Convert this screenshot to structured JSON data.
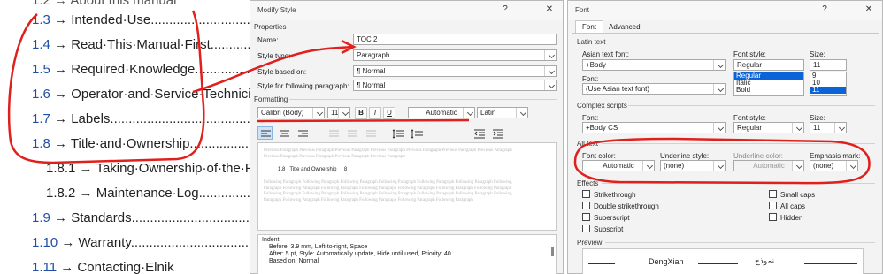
{
  "document": {
    "top_partial": "1.2 → About this manual",
    "toc": [
      {
        "num": "1.3",
        "text": "→ Intended·Use..........................................."
      },
      {
        "num": "1.4",
        "text": "→ Read·This·Manual·First..............................."
      },
      {
        "num": "1.5",
        "text": "→ Required·Knowledge.................................."
      },
      {
        "num": "1.6",
        "text": "→ Operator·and·Service·Technician"
      },
      {
        "num": "1.7",
        "text": "→ Labels..............................................."
      },
      {
        "num": "1.8",
        "text": "→ Title·and·Ownership........................"
      },
      {
        "num": "1.8.1",
        "text": "→ Taking·Ownership·of·the·F"
      },
      {
        "num": "1.8.2",
        "text": "→ Maintenance·Log.........................."
      },
      {
        "num": "1.9",
        "text": "→ Standards............................................"
      },
      {
        "num": "1.10",
        "text": "→ Warranty............................................"
      },
      {
        "num": "1.11",
        "text": "→ Contacting·Elnik"
      }
    ]
  },
  "modify_style": {
    "title": "Modify Style",
    "help": "?",
    "close": "✕",
    "properties_label": "Properties",
    "name_label": "Name:",
    "name_value": "TOC 2",
    "style_type_label": "Style type:",
    "style_type_value": "Paragraph",
    "style_based_label": "Style based on:",
    "style_based_value": "¶  Normal",
    "style_following_label": "Style for following paragraph:",
    "style_following_value": "¶  Normal",
    "formatting_label": "Formatting",
    "font_value": "Calibri (Body)",
    "size_value": "11",
    "bold": "B",
    "italic": "I",
    "underline": "U",
    "color_value": "Automatic",
    "script_value": "Latin",
    "preview_previous": "Previous Paragraph Previous Paragraph Previous Paragraph Previous Paragraph Previous Paragraph Previous Paragraph Previous Paragraph Previous Paragraph Previous Paragraph Previous Paragraph Previous Paragraph",
    "preview_sample_num": "1.8",
    "preview_sample_text": "Title and Ownership",
    "preview_sample_page": "8",
    "preview_following": "Following Paragraph Following Paragraph Following Paragraph Following Paragraph Following Paragraph Following Paragraph Following Paragraph Following Paragraph Following Paragraph Following Paragraph Following Paragraph Following Paragraph Following Paragraph Following Paragraph Following Paragraph Following Paragraph Following Paragraph Following Paragraph Following Paragraph Following Paragraph Following Paragraph Following Paragraph Following Paragraph Following Paragraph Following Paragraph",
    "desc_line1": "Indent:",
    "desc_line2": "Before:  3.9 mm, Left-to-right, Space",
    "desc_line3": "After:  5 pt, Style: Automatically update, Hide until used, Priority: 40",
    "desc_line4": "Based on: Normal"
  },
  "font_dialog": {
    "title": "Font",
    "help": "?",
    "close": "✕",
    "tab_font": "Font",
    "tab_advanced": "Advanced",
    "latin_text_label": "Latin text",
    "asian_font_label": "Asian text font:",
    "asian_font_value": "+Body",
    "font_label": "Font:",
    "font_value": "(Use Asian text font)",
    "font_style_label": "Font style:",
    "font_style_value": "Regular",
    "font_style_options": [
      "Regular",
      "Italic",
      "Bold"
    ],
    "size_label": "Size:",
    "size_value": "11",
    "size_options": [
      "9",
      "10",
      "11"
    ],
    "complex_scripts_label": "Complex scripts",
    "complex_font_label": "Font:",
    "complex_font_value": "+Body CS",
    "complex_style_label": "Font style:",
    "complex_style_value": "Regular",
    "complex_size_label": "Size:",
    "complex_size_value": "11",
    "all_text_label": "All text",
    "font_color_label": "Font color:",
    "font_color_value": "Automatic",
    "underline_style_label": "Underline style:",
    "underline_style_value": "(none)",
    "underline_color_label": "Underline color:",
    "underline_color_value": "Automatic",
    "emphasis_label": "Emphasis mark:",
    "emphasis_value": "(none)",
    "effects_label": "Effects",
    "strikethrough": "Strikethrough",
    "double_strikethrough": "Double strikethrough",
    "superscript": "Superscript",
    "subscript": "Subscript",
    "small_caps": "Small caps",
    "all_caps": "All caps",
    "hidden": "Hidden",
    "preview_label": "Preview",
    "preview_latin": "DengXian",
    "preview_complex": "نموذج"
  },
  "colors": {
    "annotation": "#e0201c",
    "toc_number": "#1f4fa8",
    "selection": "#0a64d8"
  }
}
